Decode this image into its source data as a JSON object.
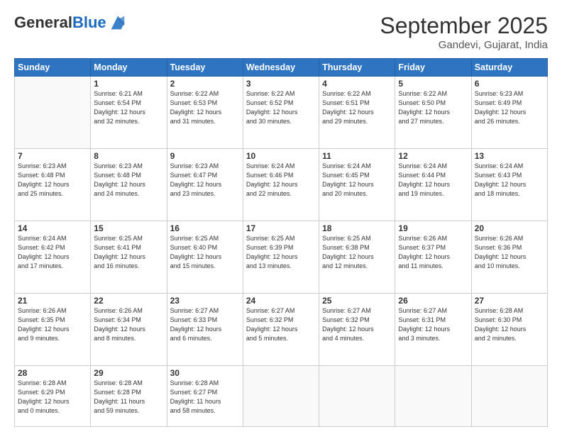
{
  "header": {
    "logo_general": "General",
    "logo_blue": "Blue",
    "month": "September 2025",
    "location": "Gandevi, Gujarat, India"
  },
  "weekdays": [
    "Sunday",
    "Monday",
    "Tuesday",
    "Wednesday",
    "Thursday",
    "Friday",
    "Saturday"
  ],
  "weeks": [
    [
      {
        "day": "",
        "info": ""
      },
      {
        "day": "1",
        "info": "Sunrise: 6:21 AM\nSunset: 6:54 PM\nDaylight: 12 hours\nand 32 minutes."
      },
      {
        "day": "2",
        "info": "Sunrise: 6:22 AM\nSunset: 6:53 PM\nDaylight: 12 hours\nand 31 minutes."
      },
      {
        "day": "3",
        "info": "Sunrise: 6:22 AM\nSunset: 6:52 PM\nDaylight: 12 hours\nand 30 minutes."
      },
      {
        "day": "4",
        "info": "Sunrise: 6:22 AM\nSunset: 6:51 PM\nDaylight: 12 hours\nand 29 minutes."
      },
      {
        "day": "5",
        "info": "Sunrise: 6:22 AM\nSunset: 6:50 PM\nDaylight: 12 hours\nand 27 minutes."
      },
      {
        "day": "6",
        "info": "Sunrise: 6:23 AM\nSunset: 6:49 PM\nDaylight: 12 hours\nand 26 minutes."
      }
    ],
    [
      {
        "day": "7",
        "info": "Sunrise: 6:23 AM\nSunset: 6:48 PM\nDaylight: 12 hours\nand 25 minutes."
      },
      {
        "day": "8",
        "info": "Sunrise: 6:23 AM\nSunset: 6:48 PM\nDaylight: 12 hours\nand 24 minutes."
      },
      {
        "day": "9",
        "info": "Sunrise: 6:23 AM\nSunset: 6:47 PM\nDaylight: 12 hours\nand 23 minutes."
      },
      {
        "day": "10",
        "info": "Sunrise: 6:24 AM\nSunset: 6:46 PM\nDaylight: 12 hours\nand 22 minutes."
      },
      {
        "day": "11",
        "info": "Sunrise: 6:24 AM\nSunset: 6:45 PM\nDaylight: 12 hours\nand 20 minutes."
      },
      {
        "day": "12",
        "info": "Sunrise: 6:24 AM\nSunset: 6:44 PM\nDaylight: 12 hours\nand 19 minutes."
      },
      {
        "day": "13",
        "info": "Sunrise: 6:24 AM\nSunset: 6:43 PM\nDaylight: 12 hours\nand 18 minutes."
      }
    ],
    [
      {
        "day": "14",
        "info": "Sunrise: 6:24 AM\nSunset: 6:42 PM\nDaylight: 12 hours\nand 17 minutes."
      },
      {
        "day": "15",
        "info": "Sunrise: 6:25 AM\nSunset: 6:41 PM\nDaylight: 12 hours\nand 16 minutes."
      },
      {
        "day": "16",
        "info": "Sunrise: 6:25 AM\nSunset: 6:40 PM\nDaylight: 12 hours\nand 15 minutes."
      },
      {
        "day": "17",
        "info": "Sunrise: 6:25 AM\nSunset: 6:39 PM\nDaylight: 12 hours\nand 13 minutes."
      },
      {
        "day": "18",
        "info": "Sunrise: 6:25 AM\nSunset: 6:38 PM\nDaylight: 12 hours\nand 12 minutes."
      },
      {
        "day": "19",
        "info": "Sunrise: 6:26 AM\nSunset: 6:37 PM\nDaylight: 12 hours\nand 11 minutes."
      },
      {
        "day": "20",
        "info": "Sunrise: 6:26 AM\nSunset: 6:36 PM\nDaylight: 12 hours\nand 10 minutes."
      }
    ],
    [
      {
        "day": "21",
        "info": "Sunrise: 6:26 AM\nSunset: 6:35 PM\nDaylight: 12 hours\nand 9 minutes."
      },
      {
        "day": "22",
        "info": "Sunrise: 6:26 AM\nSunset: 6:34 PM\nDaylight: 12 hours\nand 8 minutes."
      },
      {
        "day": "23",
        "info": "Sunrise: 6:27 AM\nSunset: 6:33 PM\nDaylight: 12 hours\nand 6 minutes."
      },
      {
        "day": "24",
        "info": "Sunrise: 6:27 AM\nSunset: 6:32 PM\nDaylight: 12 hours\nand 5 minutes."
      },
      {
        "day": "25",
        "info": "Sunrise: 6:27 AM\nSunset: 6:32 PM\nDaylight: 12 hours\nand 4 minutes."
      },
      {
        "day": "26",
        "info": "Sunrise: 6:27 AM\nSunset: 6:31 PM\nDaylight: 12 hours\nand 3 minutes."
      },
      {
        "day": "27",
        "info": "Sunrise: 6:28 AM\nSunset: 6:30 PM\nDaylight: 12 hours\nand 2 minutes."
      }
    ],
    [
      {
        "day": "28",
        "info": "Sunrise: 6:28 AM\nSunset: 6:29 PM\nDaylight: 12 hours\nand 0 minutes."
      },
      {
        "day": "29",
        "info": "Sunrise: 6:28 AM\nSunset: 6:28 PM\nDaylight: 11 hours\nand 59 minutes."
      },
      {
        "day": "30",
        "info": "Sunrise: 6:28 AM\nSunset: 6:27 PM\nDaylight: 11 hours\nand 58 minutes."
      },
      {
        "day": "",
        "info": ""
      },
      {
        "day": "",
        "info": ""
      },
      {
        "day": "",
        "info": ""
      },
      {
        "day": "",
        "info": ""
      }
    ]
  ]
}
